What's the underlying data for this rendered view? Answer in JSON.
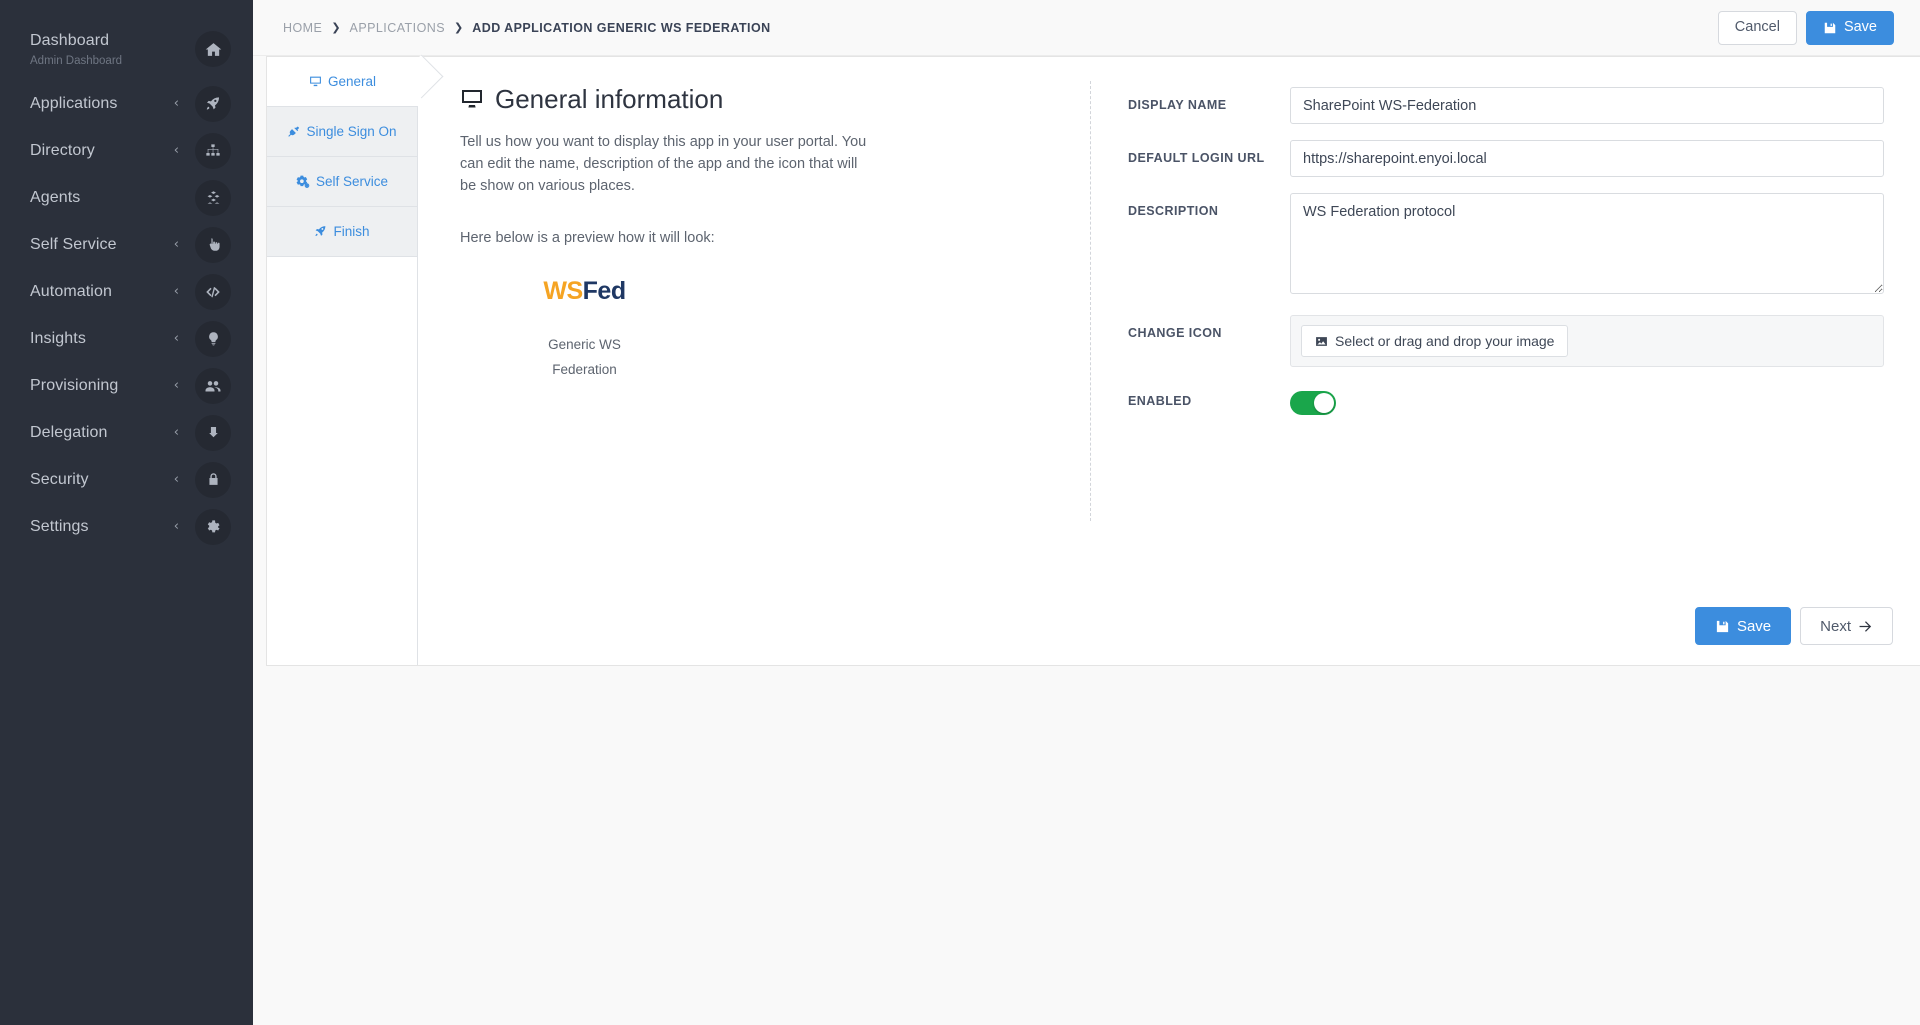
{
  "sidebar": {
    "items": [
      {
        "label": "Dashboard",
        "sublabel": "Admin Dashboard",
        "icon": "home-icon",
        "caret": ""
      },
      {
        "label": "Applications",
        "sublabel": "",
        "icon": "rocket-icon",
        "caret": "‹"
      },
      {
        "label": "Directory",
        "sublabel": "",
        "icon": "sitemap-icon",
        "caret": "‹"
      },
      {
        "label": "Agents",
        "sublabel": "",
        "icon": "cubes-icon",
        "caret": ""
      },
      {
        "label": "Self Service",
        "sublabel": "",
        "icon": "hand-pointer-icon",
        "caret": "‹"
      },
      {
        "label": "Automation",
        "sublabel": "",
        "icon": "code-icon",
        "caret": "‹"
      },
      {
        "label": "Insights",
        "sublabel": "",
        "icon": "lightbulb-icon",
        "caret": "‹"
      },
      {
        "label": "Provisioning",
        "sublabel": "",
        "icon": "users-icon",
        "caret": "‹"
      },
      {
        "label": "Delegation",
        "sublabel": "",
        "icon": "arrow-turn-down-icon",
        "caret": "‹"
      },
      {
        "label": "Security",
        "sublabel": "",
        "icon": "lock-icon",
        "caret": "‹"
      },
      {
        "label": "Settings",
        "sublabel": "",
        "icon": "gear-icon",
        "caret": "‹"
      }
    ]
  },
  "topbar": {
    "breadcrumbs": [
      {
        "label": "HOME",
        "active": false
      },
      {
        "label": "APPLICATIONS",
        "active": false
      },
      {
        "label": "ADD APPLICATION GENERIC WS FEDERATION",
        "active": true
      }
    ],
    "separator": "❯",
    "cancel_label": "Cancel",
    "save_label": "Save"
  },
  "wizard": {
    "tabs": [
      {
        "label": "General",
        "icon": "desktop-icon",
        "active": true
      },
      {
        "label": "Single Sign On",
        "icon": "plug-icon",
        "active": false
      },
      {
        "label": "Self Service",
        "icon": "cogs-icon",
        "active": false
      },
      {
        "label": "Finish",
        "icon": "rocket-icon",
        "active": false
      }
    ]
  },
  "info": {
    "title": "General information",
    "paragraph": "Tell us how you want to display this app in your user portal. You can edit the name, description of the app and the icon that will be show on various places.",
    "preview_intro": "Here below is a preview how it will look:",
    "logo_part1": "WS",
    "logo_part2": "Fed",
    "logo_color1": "#f5a423",
    "logo_color2": "#1f3864",
    "app_name_line1": "Generic WS",
    "app_name_line2": "Federation"
  },
  "form": {
    "display_name": {
      "label": "DISPLAY NAME",
      "value": "SharePoint WS-Federation",
      "placeholder": ""
    },
    "default_login_url": {
      "label": "DEFAULT LOGIN URL",
      "value": "https://sharepoint.enyoi.local",
      "placeholder": ""
    },
    "description": {
      "label": "DESCRIPTION",
      "value": "WS Federation protocol",
      "placeholder": ""
    },
    "change_icon": {
      "label": "CHANGE ICON",
      "button_label": "Select or drag and drop your image"
    },
    "enabled": {
      "label": "ENABLED",
      "state": "on",
      "color": "#1aa64b"
    }
  },
  "footer": {
    "save_label": "Save",
    "next_label": "Next"
  },
  "theme": {
    "accent": "#3c8dde",
    "sidebar_bg": "#2b303b",
    "page_bg": "#f9f9f9"
  }
}
